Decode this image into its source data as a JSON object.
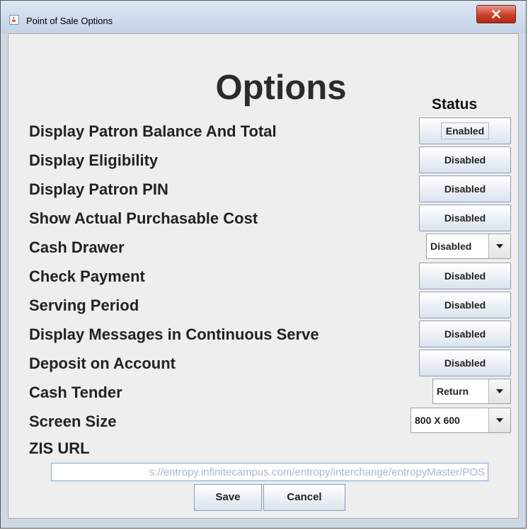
{
  "window": {
    "title": "Point of Sale Options",
    "close_icon": "close-x-icon",
    "app_icon": "java-cup-icon"
  },
  "heading": "Options",
  "status_header": "Status",
  "options": [
    {
      "label": "Display Patron Balance And Total",
      "control": "toggle",
      "value": "Enabled"
    },
    {
      "label": "Display Eligibility",
      "control": "toggle",
      "value": "Disabled"
    },
    {
      "label": "Display Patron PIN",
      "control": "toggle",
      "value": "Disabled"
    },
    {
      "label": "Show Actual Purchasable Cost",
      "control": "toggle",
      "value": "Disabled"
    },
    {
      "label": "Cash Drawer",
      "control": "dropdown",
      "value": "Disabled"
    },
    {
      "label": "Check Payment",
      "control": "toggle",
      "value": "Disabled"
    },
    {
      "label": "Serving Period",
      "control": "toggle",
      "value": "Disabled"
    },
    {
      "label": "Display Messages in Continuous Serve",
      "control": "toggle",
      "value": "Disabled"
    },
    {
      "label": "Deposit on Account",
      "control": "toggle",
      "value": "Disabled"
    },
    {
      "label": "Cash Tender",
      "control": "dropdown",
      "value": "Return"
    },
    {
      "label": "Screen Size",
      "control": "dropdown",
      "value": "800 X 600"
    },
    {
      "label": "ZIS URL"
    }
  ],
  "zis_url": {
    "value": "s://entropy.infinitecampus.com/entropy/interchange/entropyMaster/POS"
  },
  "buttons": {
    "save": "Save",
    "cancel": "Cancel"
  }
}
